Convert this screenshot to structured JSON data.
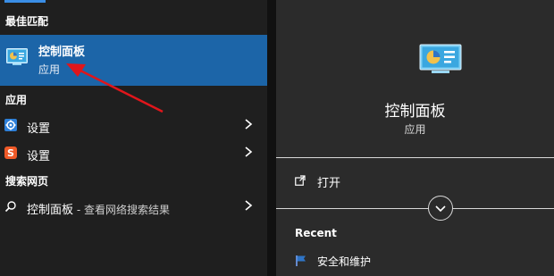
{
  "left": {
    "best_match_heading": "最佳匹配",
    "best_match": {
      "title": "控制面板",
      "subtitle": "应用"
    },
    "apps_heading": "应用",
    "apps": [
      {
        "label": "设置",
        "icon": "settings-gear-icon"
      },
      {
        "label": "设置",
        "icon": "sogou-settings-icon"
      }
    ],
    "web_heading": "搜索网页",
    "web_result": {
      "query": "控制面板",
      "suffix": " - 查看网络搜索结果"
    }
  },
  "right": {
    "title": "控制面板",
    "subtitle": "应用",
    "open_label": "打开",
    "recent_heading": "Recent",
    "recent_items": [
      {
        "label": "安全和维护",
        "icon": "flag-icon"
      }
    ]
  },
  "colors": {
    "highlight": "#1c65a8",
    "annotation_arrow": "#e0161b",
    "accent": "#3a8ee6"
  }
}
